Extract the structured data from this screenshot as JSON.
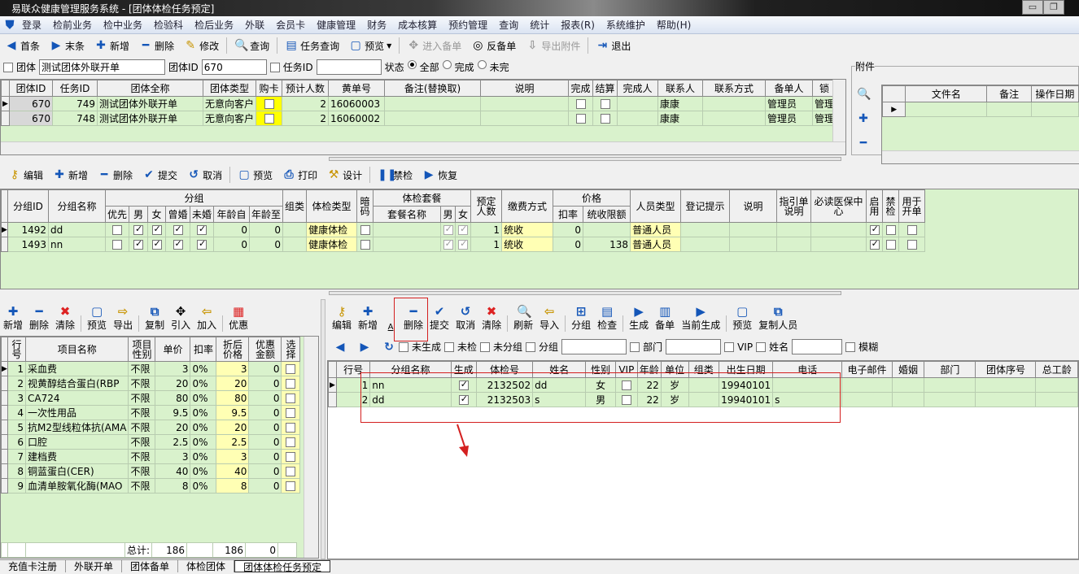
{
  "window": {
    "title": "易联众健康管理服务系统 - [团体体检任务预定]",
    "minimize": "▭",
    "restore": "❐"
  },
  "menu": [
    "登录",
    "检前业务",
    "检中业务",
    "检验科",
    "检后业务",
    "外联",
    "会员卡",
    "健康管理",
    "财务",
    "成本核算",
    "预约管理",
    "查询",
    "统计",
    "报表(R)",
    "系统维护",
    "帮助(H)"
  ],
  "toolbar": [
    {
      "label": "首条",
      "icon": "first-icon",
      "glyph": "◀",
      "cls": "blue"
    },
    {
      "label": "末条",
      "icon": "last-icon",
      "glyph": "▶",
      "cls": "blue"
    },
    {
      "label": "新增",
      "icon": "plus-icon",
      "glyph": "✚",
      "cls": "blue"
    },
    {
      "label": "删除",
      "icon": "minus-icon",
      "glyph": "━",
      "cls": "blue"
    },
    {
      "label": "修改",
      "icon": "pencil-icon",
      "glyph": "✎",
      "cls": "gold",
      "sep": true
    },
    {
      "label": "查询",
      "icon": "search-icon",
      "glyph": "🔍",
      "cls": "gold",
      "sep": true
    },
    {
      "label": "任务查询",
      "icon": "task-query-icon",
      "glyph": "▤",
      "cls": "blue"
    },
    {
      "label": "预览",
      "icon": "preview-icon",
      "glyph": "▢",
      "cls": "blue",
      "dd": true,
      "sep": true
    },
    {
      "label": "进入备单",
      "icon": "enter-order-icon",
      "glyph": "✥",
      "cls": "",
      "dis": true
    },
    {
      "label": "反备单",
      "icon": "reverse-order-icon",
      "glyph": "◎",
      "cls": ""
    },
    {
      "label": "导出附件",
      "icon": "export-attachment-icon",
      "glyph": "⇩",
      "cls": "",
      "dis": true,
      "sep": true
    },
    {
      "label": "退出",
      "icon": "exit-icon",
      "glyph": "⇥",
      "cls": "blue"
    }
  ],
  "filter": {
    "group_label": "团体",
    "group_value": "测试团体外联开单",
    "group_id_label": "团体ID",
    "group_id_value": "670",
    "task_id_label": "任务ID",
    "task_id_value": "",
    "status_label": "状态",
    "status_options": [
      "全部",
      "完成",
      "未完"
    ],
    "status_selected": "全部"
  },
  "tasks": {
    "headers": [
      "团体ID",
      "任务ID",
      "团体全称",
      "团体类型",
      "购卡",
      "预计人数",
      "黄单号",
      "备注(替换取)",
      "说明",
      "完成",
      "结算",
      "完成人",
      "联系人",
      "联系方式",
      "备单人",
      "锁"
    ],
    "rows": [
      [
        "670",
        "749",
        "测试团体外联开单",
        "无意向客户",
        false,
        "2",
        "16060003",
        "",
        "",
        false,
        false,
        "",
        "康康",
        "",
        "管理员",
        "管理"
      ],
      [
        "670",
        "748",
        "测试团体外联开单",
        "无意向客户",
        false,
        "2",
        "16060002",
        "",
        "",
        false,
        false,
        "",
        "康康",
        "",
        "管理员",
        "管理"
      ]
    ]
  },
  "attachments": {
    "title": "附件",
    "headers": [
      "文件名",
      "备注",
      "操作日期"
    ]
  },
  "group_toolbar": [
    "编辑",
    "新增",
    "删除",
    "提交",
    "取消",
    "预览",
    "打印",
    "设计",
    "禁检",
    "恢复"
  ],
  "groups": {
    "h": {
      "id": "分组ID",
      "name": "分组名称",
      "group": "分组",
      "prio": "优先",
      "male": "男",
      "female": "女",
      "married": "曾婚",
      "single": "未婚",
      "age_from": "年龄自",
      "age_to": "年龄至",
      "cls": "组类",
      "type": "体检类型",
      "code": "暗码",
      "package": "体检套餐",
      "pkg_name": "套餐名称",
      "pkg_m": "男",
      "pkg_f": "女",
      "count": "预定人数",
      "pay": "缴费方式",
      "price": "价格",
      "rate": "扣率",
      "limit": "统收限额",
      "ptype": "人员类型",
      "hint": "登记提示",
      "desc": "说明",
      "guide": "指引单说明",
      "ins": "必读医保中心",
      "enable": "启用",
      "ban": "禁检",
      "order": "用于开单"
    },
    "rows": [
      [
        "1492",
        "dd",
        false,
        true,
        true,
        true,
        true,
        "0",
        "0",
        "",
        "健康体检",
        false,
        "",
        true,
        true,
        "1",
        "统收",
        "0",
        "",
        "普通人员",
        "",
        "",
        "",
        "",
        true,
        false,
        false
      ],
      [
        "1493",
        "nn",
        false,
        true,
        true,
        true,
        true,
        "0",
        "0",
        "",
        "健康体检",
        false,
        "",
        true,
        true,
        "1",
        "统收",
        "0",
        "138",
        "普通人员",
        "",
        "",
        "",
        "",
        true,
        false,
        false
      ]
    ]
  },
  "items_toolbar": [
    "新增",
    "删除",
    "清除",
    "预览",
    "导出",
    "复制",
    "引入",
    "加入",
    "优惠"
  ],
  "items": {
    "headers": [
      "行号",
      "项目名称",
      "项目性别",
      "单价",
      "扣率",
      "折后价格",
      "优惠金额",
      "选择"
    ],
    "rows": [
      [
        "1",
        "采血费",
        "不限",
        "3",
        "0%",
        "3",
        "0",
        false
      ],
      [
        "2",
        "视黄醇结合蛋白(RBP",
        "不限",
        "20",
        "0%",
        "20",
        "0",
        false
      ],
      [
        "3",
        "CA724",
        "不限",
        "80",
        "0%",
        "80",
        "0",
        false
      ],
      [
        "4",
        "一次性用品",
        "不限",
        "9.5",
        "0%",
        "9.5",
        "0",
        false
      ],
      [
        "5",
        "抗M2型线粒体抗(AMA",
        "不限",
        "20",
        "0%",
        "20",
        "0",
        false
      ],
      [
        "6",
        "口腔",
        "不限",
        "2.5",
        "0%",
        "2.5",
        "0",
        false
      ],
      [
        "7",
        "建档费",
        "不限",
        "3",
        "0%",
        "3",
        "0",
        false
      ],
      [
        "8",
        "铜蓝蛋白(CER)",
        "不限",
        "40",
        "0%",
        "40",
        "0",
        false
      ],
      [
        "9",
        "血清单胺氧化酶(MAO",
        "不限",
        "8",
        "0%",
        "8",
        "0",
        false
      ]
    ],
    "total_label": "总计:",
    "total_price": "186",
    "total_after": "186",
    "total_discount": "0"
  },
  "people_toolbar": [
    "编辑",
    "新增",
    "A",
    "删除",
    "提交",
    "取消",
    "清除",
    "刷新",
    "导入",
    "分组",
    "检查",
    "生成",
    "备单",
    "当前生成",
    "预览",
    "复制人员"
  ],
  "people_filter": {
    "not_generated": "未生成",
    "not_checked": "未检",
    "ungrouped": "未分组",
    "group": "分组",
    "dept": "部门",
    "vip": "VIP",
    "name": "姓名",
    "fuzzy": "模糊"
  },
  "people": {
    "headers": [
      "行号",
      "分组名称",
      "生成",
      "体检号",
      "姓名",
      "性别",
      "VIP",
      "年龄",
      "单位",
      "组类",
      "出生日期",
      "电话",
      "电子邮件",
      "婚姻",
      "部门",
      "团体序号",
      "总工龄"
    ],
    "rows": [
      [
        "1",
        "nn",
        true,
        "2132502",
        "dd",
        "女",
        false,
        "22",
        "岁",
        "",
        "19940101",
        "",
        "",
        "",
        "",
        "",
        ""
      ],
      [
        "2",
        "dd",
        true,
        "2132503",
        "s",
        "男",
        false,
        "22",
        "岁",
        "",
        "19940101",
        "s",
        "",
        "",
        "",
        "",
        ""
      ]
    ]
  },
  "tabs": [
    "充值卡注册",
    "外联开单",
    "团体备单",
    "体检团体",
    "团体体检任务预定"
  ],
  "active_tab": "团体体检任务预定",
  "annotation_color": "#d42020"
}
